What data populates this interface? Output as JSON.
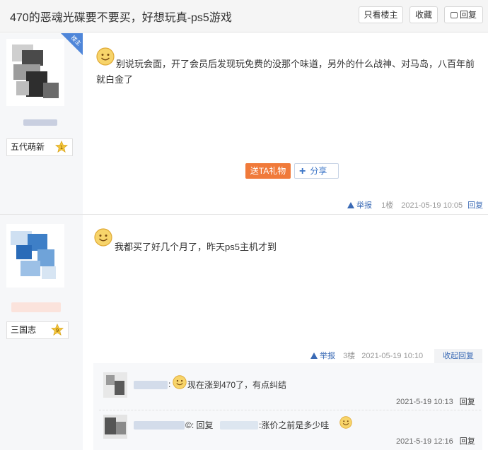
{
  "header": {
    "title": "470的恶魂光碟要不要买，好想玩真-ps5游戏",
    "only_op_label": "只看楼主",
    "favorite_label": "收藏",
    "reply_label": "回复"
  },
  "posts": [
    {
      "op_badge": "楼主",
      "username": "五代萌新",
      "level": "1",
      "content": "别说玩会面，开了会员后发现玩免费的没那个味道，另外的什么战神、对马岛，八百年前就白金了",
      "gift_label": "送TA礼物",
      "share_label": "分享",
      "report_label": "举报",
      "floor": "1楼",
      "time": "2021-05-19 10:05",
      "reply_label": "回复"
    },
    {
      "username": "三国志",
      "level": "9",
      "content": "我都买了好几个月了，昨天ps5主机才到",
      "report_label": "举报",
      "floor": "3楼",
      "time": "2021-05-19 10:10",
      "collapse_label": "收起回复",
      "replies": [
        {
          "prefix": ":",
          "text": "现在涨到470了，有点纠结",
          "time": "2021-5-19 10:13",
          "reply_label": "回复"
        },
        {
          "prefix": "©: 回复",
          "text": ":涨价之前是多少哇",
          "time": "2021-5-19 12:16",
          "reply_label": "回复"
        }
      ]
    }
  ],
  "colors": {
    "accent_blue": "#3a6ab5",
    "gift_orange": "#f07a3a",
    "badge_blue": "#4f86d9",
    "star_gold": "#f3c53a"
  }
}
